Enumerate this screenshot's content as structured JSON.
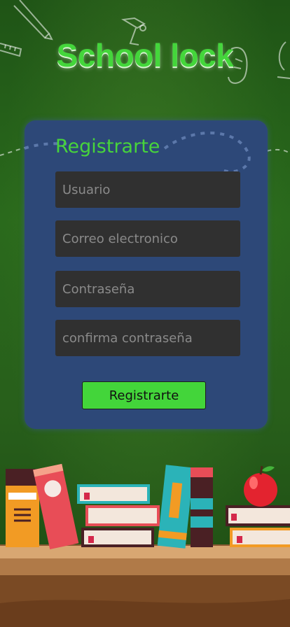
{
  "app": {
    "title": "School lock"
  },
  "form": {
    "heading": "Registrarte",
    "fields": [
      {
        "name": "usuario",
        "placeholder": "Usuario"
      },
      {
        "name": "correo",
        "placeholder": "Correo electronico"
      },
      {
        "name": "contrasena",
        "placeholder": "Contraseña"
      },
      {
        "name": "confirma",
        "placeholder": "confirma contraseña"
      }
    ],
    "submit_label": "Registrarte"
  },
  "colors": {
    "accent": "#43d53a",
    "background": "#285f1b",
    "card": "#2d4878",
    "field": "#303030"
  }
}
